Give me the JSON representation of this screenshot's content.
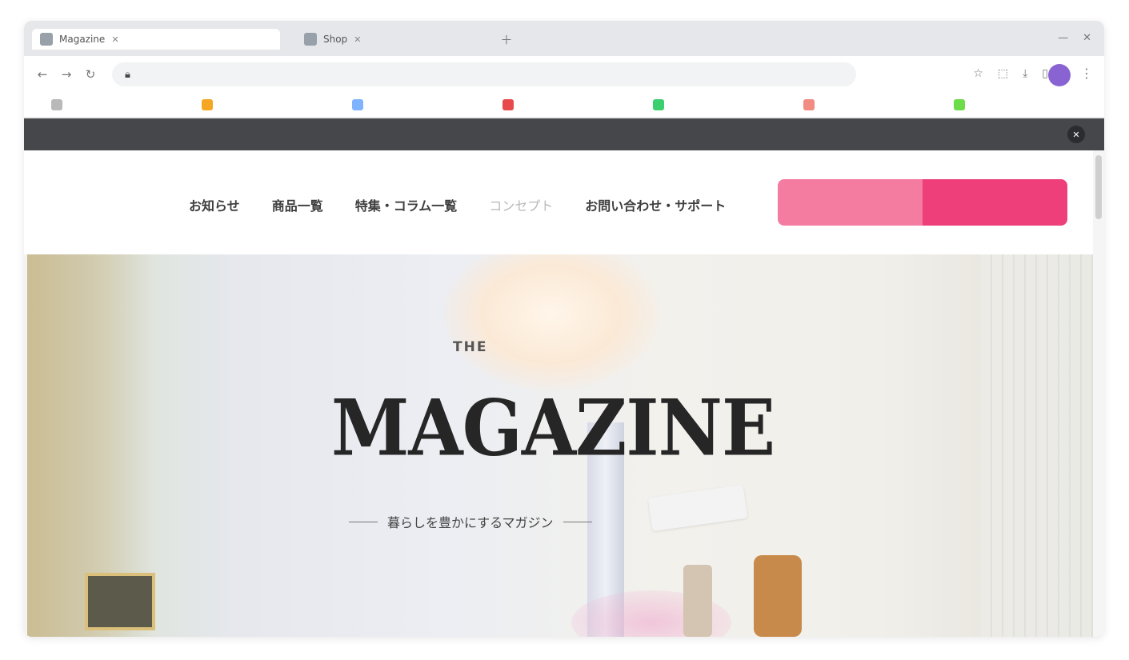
{
  "browser": {
    "tabs": [
      {
        "label": "Magazine",
        "active": true
      },
      {
        "label": "Shop"
      }
    ],
    "omnibox_text": "",
    "bookmarks": [
      {
        "label": "",
        "color": "#b9b9b9"
      },
      {
        "label": "",
        "color": "#f5a623"
      },
      {
        "label": "",
        "color": "#7fb3ff"
      },
      {
        "label": "",
        "color": "#e64a4a"
      },
      {
        "label": "",
        "color": "#3ccf6e"
      },
      {
        "label": "",
        "color": "#f28b82"
      },
      {
        "label": "",
        "color": "#6ddc4a"
      }
    ],
    "profile_color": "#8a63d2"
  },
  "announcement": {
    "text": ""
  },
  "site": {
    "nav": [
      "お知らせ",
      "商品一覧",
      "特集・コラム一覧",
      "コンセプト",
      "お問い合わせ・サポート"
    ],
    "top_link": "",
    "cta_primary": "",
    "cta_secondary": ""
  },
  "hero": {
    "logo_small": "THE",
    "logo_big": "MAGAZINE",
    "tagline": "暮らしを豊かにするマガジン"
  },
  "colors": {
    "announce_bg": "#45474b",
    "cta_light": "#f47ca1",
    "cta_dark": "#ee3f7b"
  }
}
